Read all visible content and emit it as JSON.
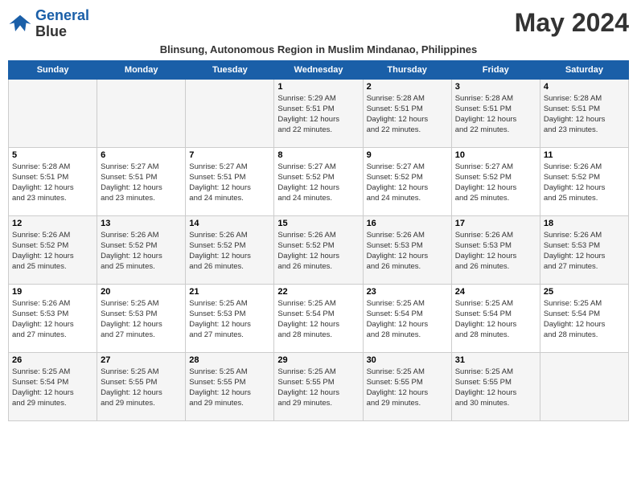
{
  "header": {
    "logo_line1": "General",
    "logo_line2": "Blue",
    "month_title": "May 2024",
    "subtitle": "Blinsung, Autonomous Region in Muslim Mindanao, Philippines"
  },
  "days_of_week": [
    "Sunday",
    "Monday",
    "Tuesday",
    "Wednesday",
    "Thursday",
    "Friday",
    "Saturday"
  ],
  "weeks": [
    [
      {
        "day": "",
        "info": ""
      },
      {
        "day": "",
        "info": ""
      },
      {
        "day": "",
        "info": ""
      },
      {
        "day": "1",
        "info": "Sunrise: 5:29 AM\nSunset: 5:51 PM\nDaylight: 12 hours\nand 22 minutes."
      },
      {
        "day": "2",
        "info": "Sunrise: 5:28 AM\nSunset: 5:51 PM\nDaylight: 12 hours\nand 22 minutes."
      },
      {
        "day": "3",
        "info": "Sunrise: 5:28 AM\nSunset: 5:51 PM\nDaylight: 12 hours\nand 22 minutes."
      },
      {
        "day": "4",
        "info": "Sunrise: 5:28 AM\nSunset: 5:51 PM\nDaylight: 12 hours\nand 23 minutes."
      }
    ],
    [
      {
        "day": "5",
        "info": "Sunrise: 5:28 AM\nSunset: 5:51 PM\nDaylight: 12 hours\nand 23 minutes."
      },
      {
        "day": "6",
        "info": "Sunrise: 5:27 AM\nSunset: 5:51 PM\nDaylight: 12 hours\nand 23 minutes."
      },
      {
        "day": "7",
        "info": "Sunrise: 5:27 AM\nSunset: 5:51 PM\nDaylight: 12 hours\nand 24 minutes."
      },
      {
        "day": "8",
        "info": "Sunrise: 5:27 AM\nSunset: 5:52 PM\nDaylight: 12 hours\nand 24 minutes."
      },
      {
        "day": "9",
        "info": "Sunrise: 5:27 AM\nSunset: 5:52 PM\nDaylight: 12 hours\nand 24 minutes."
      },
      {
        "day": "10",
        "info": "Sunrise: 5:27 AM\nSunset: 5:52 PM\nDaylight: 12 hours\nand 25 minutes."
      },
      {
        "day": "11",
        "info": "Sunrise: 5:26 AM\nSunset: 5:52 PM\nDaylight: 12 hours\nand 25 minutes."
      }
    ],
    [
      {
        "day": "12",
        "info": "Sunrise: 5:26 AM\nSunset: 5:52 PM\nDaylight: 12 hours\nand 25 minutes."
      },
      {
        "day": "13",
        "info": "Sunrise: 5:26 AM\nSunset: 5:52 PM\nDaylight: 12 hours\nand 25 minutes."
      },
      {
        "day": "14",
        "info": "Sunrise: 5:26 AM\nSunset: 5:52 PM\nDaylight: 12 hours\nand 26 minutes."
      },
      {
        "day": "15",
        "info": "Sunrise: 5:26 AM\nSunset: 5:52 PM\nDaylight: 12 hours\nand 26 minutes."
      },
      {
        "day": "16",
        "info": "Sunrise: 5:26 AM\nSunset: 5:53 PM\nDaylight: 12 hours\nand 26 minutes."
      },
      {
        "day": "17",
        "info": "Sunrise: 5:26 AM\nSunset: 5:53 PM\nDaylight: 12 hours\nand 26 minutes."
      },
      {
        "day": "18",
        "info": "Sunrise: 5:26 AM\nSunset: 5:53 PM\nDaylight: 12 hours\nand 27 minutes."
      }
    ],
    [
      {
        "day": "19",
        "info": "Sunrise: 5:26 AM\nSunset: 5:53 PM\nDaylight: 12 hours\nand 27 minutes."
      },
      {
        "day": "20",
        "info": "Sunrise: 5:25 AM\nSunset: 5:53 PM\nDaylight: 12 hours\nand 27 minutes."
      },
      {
        "day": "21",
        "info": "Sunrise: 5:25 AM\nSunset: 5:53 PM\nDaylight: 12 hours\nand 27 minutes."
      },
      {
        "day": "22",
        "info": "Sunrise: 5:25 AM\nSunset: 5:54 PM\nDaylight: 12 hours\nand 28 minutes."
      },
      {
        "day": "23",
        "info": "Sunrise: 5:25 AM\nSunset: 5:54 PM\nDaylight: 12 hours\nand 28 minutes."
      },
      {
        "day": "24",
        "info": "Sunrise: 5:25 AM\nSunset: 5:54 PM\nDaylight: 12 hours\nand 28 minutes."
      },
      {
        "day": "25",
        "info": "Sunrise: 5:25 AM\nSunset: 5:54 PM\nDaylight: 12 hours\nand 28 minutes."
      }
    ],
    [
      {
        "day": "26",
        "info": "Sunrise: 5:25 AM\nSunset: 5:54 PM\nDaylight: 12 hours\nand 29 minutes."
      },
      {
        "day": "27",
        "info": "Sunrise: 5:25 AM\nSunset: 5:55 PM\nDaylight: 12 hours\nand 29 minutes."
      },
      {
        "day": "28",
        "info": "Sunrise: 5:25 AM\nSunset: 5:55 PM\nDaylight: 12 hours\nand 29 minutes."
      },
      {
        "day": "29",
        "info": "Sunrise: 5:25 AM\nSunset: 5:55 PM\nDaylight: 12 hours\nand 29 minutes."
      },
      {
        "day": "30",
        "info": "Sunrise: 5:25 AM\nSunset: 5:55 PM\nDaylight: 12 hours\nand 29 minutes."
      },
      {
        "day": "31",
        "info": "Sunrise: 5:25 AM\nSunset: 5:55 PM\nDaylight: 12 hours\nand 30 minutes."
      },
      {
        "day": "",
        "info": ""
      }
    ]
  ]
}
